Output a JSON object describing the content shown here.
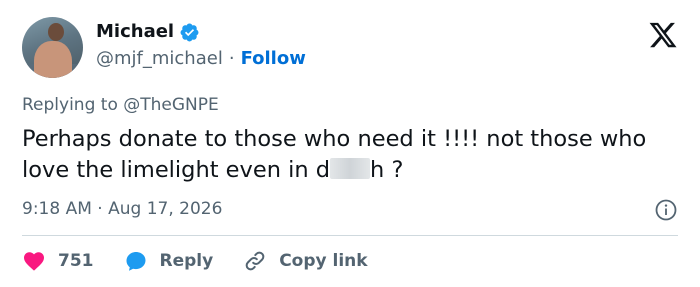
{
  "author": {
    "display_name": "Michael",
    "handle": "@mjf_michael",
    "separator": "·",
    "follow_label": "Follow"
  },
  "reply_context": {
    "prefix": "Replying to",
    "mention": "@TheGNPE"
  },
  "tweet": {
    "text_before": "Perhaps donate to those who need it !!!! not those who love the limelight even in d",
    "text_after": "h ?"
  },
  "meta": {
    "time": "9:18 AM",
    "separator": "·",
    "date": "Aug 17, 2026"
  },
  "actions": {
    "like_count": "751",
    "reply_label": "Reply",
    "copy_label": "Copy link"
  },
  "colors": {
    "accent": "#006fd6",
    "like": "#f91880",
    "reply_icon": "#1d9bf0",
    "muted": "#536471"
  },
  "icons": [
    "verified-badge-icon",
    "x-logo-icon",
    "info-icon",
    "heart-icon",
    "reply-bubble-icon",
    "link-icon"
  ]
}
